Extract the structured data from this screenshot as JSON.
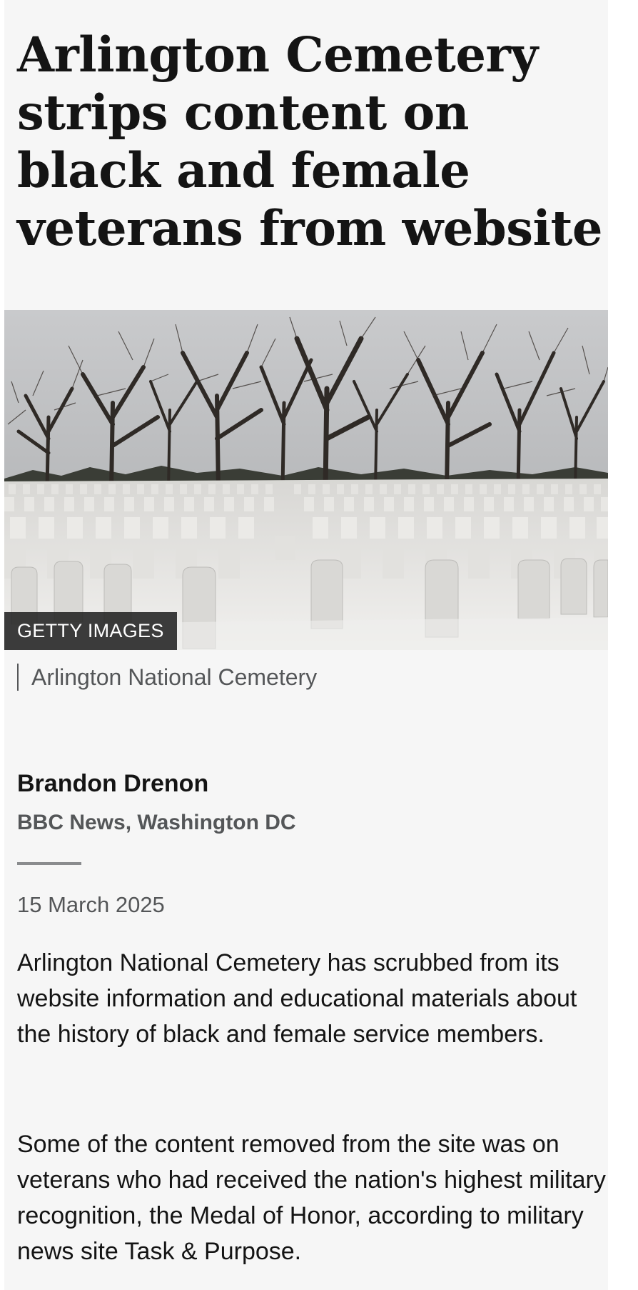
{
  "article": {
    "headline": "Arlington Cemetery strips content on black and female veterans from website",
    "image": {
      "credit": "GETTY IMAGES",
      "caption": "Arlington National Cemetery"
    },
    "byline": {
      "author": "Brandon Drenon",
      "organization": "BBC News, Washington DC"
    },
    "date": "15 March 2025",
    "paragraphs": [
      "Arlington National Cemetery has scrubbed from its website information and educational materials about the history of black and female service members.",
      "Some of the content removed from the site was on veterans who had received the nation's highest military recognition, the Medal of Honor, according to military news site Task & Purpose."
    ]
  },
  "colors": {
    "page_background": "#f6f6f6",
    "headline_text": "#141414",
    "secondary_text": "#545658",
    "credit_background": "#222222"
  }
}
